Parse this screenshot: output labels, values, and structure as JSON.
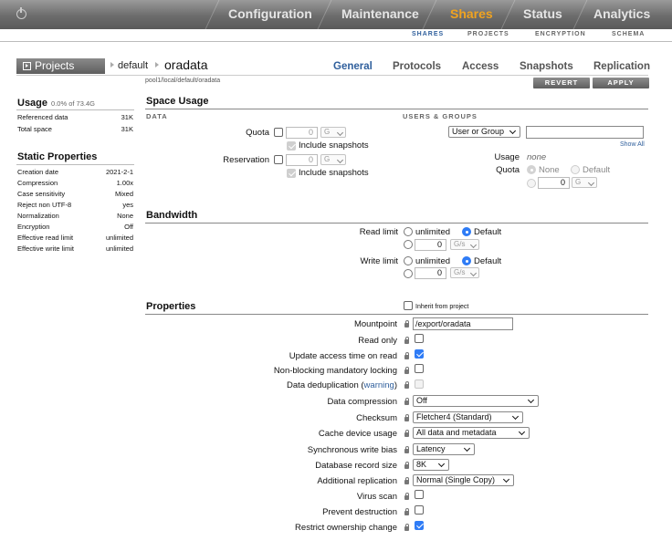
{
  "nav": {
    "main": [
      {
        "label": "Configuration"
      },
      {
        "label": "Maintenance"
      },
      {
        "label": "Shares",
        "active": true
      },
      {
        "label": "Status"
      },
      {
        "label": "Analytics"
      }
    ],
    "sub": [
      {
        "label": "SHARES",
        "active": true
      },
      {
        "label": "PROJECTS"
      },
      {
        "label": "ENCRYPTION"
      },
      {
        "label": "SCHEMA"
      }
    ]
  },
  "header": {
    "projects_label": "Projects",
    "crumb_project": "default",
    "crumb_share": "oradata",
    "path": "pool1/local/default/oradata",
    "tabs": [
      {
        "label": "General",
        "active": true
      },
      {
        "label": "Protocols"
      },
      {
        "label": "Access"
      },
      {
        "label": "Snapshots"
      },
      {
        "label": "Replication"
      }
    ],
    "revert_label": "REVERT",
    "apply_label": "APPLY"
  },
  "usage": {
    "title": "Usage",
    "summary": "0.0% of 73.4G",
    "rows": [
      {
        "k": "Referenced data",
        "v": "31K"
      },
      {
        "k": "Total space",
        "v": "31K"
      }
    ]
  },
  "static_props": {
    "title": "Static Properties",
    "rows": [
      {
        "k": "Creation date",
        "v": "2021-2-1"
      },
      {
        "k": "Compression",
        "v": "1.00x"
      },
      {
        "k": "Case sensitivity",
        "v": "Mixed"
      },
      {
        "k": "Reject non UTF-8",
        "v": "yes"
      },
      {
        "k": "Normalization",
        "v": "None"
      },
      {
        "k": "Encryption",
        "v": "Off"
      },
      {
        "k": "Effective read limit",
        "v": "unlimited"
      },
      {
        "k": "Effective write limit",
        "v": "unlimited"
      }
    ]
  },
  "space_usage": {
    "title": "Space Usage",
    "data_caption": "DATA",
    "users_caption": "USERS & GROUPS",
    "quota_label": "Quota",
    "quota_value": "0",
    "quota_unit": "G",
    "include_snapshots": "Include snapshots",
    "reservation_label": "Reservation",
    "reservation_value": "0",
    "reservation_unit": "G",
    "user_group_select": "User or Group",
    "show_all": "Show All",
    "ug_usage_label": "Usage",
    "ug_usage_value": "none",
    "ug_quota_label": "Quota",
    "ug_none": "None",
    "ug_default": "Default",
    "ug_quota_value": "0",
    "ug_quota_unit": "G"
  },
  "bandwidth": {
    "title": "Bandwidth",
    "read_label": "Read limit",
    "write_label": "Write limit",
    "unlimited": "unlimited",
    "default": "Default",
    "read_value": "0",
    "write_value": "0",
    "unit": "G/s"
  },
  "properties": {
    "title": "Properties",
    "inherit": "Inherit from project",
    "rows": {
      "mountpoint": {
        "label": "Mountpoint",
        "value": "/export/oradata"
      },
      "readonly": {
        "label": "Read only",
        "checked": false
      },
      "atime": {
        "label": "Update access time on read",
        "checked": true
      },
      "nbmand": {
        "label": "Non-blocking mandatory locking",
        "checked": false
      },
      "dedup": {
        "label": "Data deduplication",
        "warning": "warning"
      },
      "compression": {
        "label": "Data compression",
        "value": "Off"
      },
      "checksum": {
        "label": "Checksum",
        "value": "Fletcher4 (Standard)"
      },
      "cache": {
        "label": "Cache device usage",
        "value": "All data and metadata"
      },
      "logbias": {
        "label": "Synchronous write bias",
        "value": "Latency"
      },
      "recordsize": {
        "label": "Database record size",
        "value": "8K"
      },
      "copies": {
        "label": "Additional replication",
        "value": "Normal (Single Copy)"
      },
      "virusscan": {
        "label": "Virus scan",
        "checked": false
      },
      "nodestroy": {
        "label": "Prevent destruction",
        "checked": false
      },
      "restrictchown": {
        "label": "Restrict ownership change",
        "checked": true
      }
    }
  },
  "colors": {
    "accent": "#f0a320",
    "link": "#2f5f9c",
    "checkbox": "#2f7cf6"
  }
}
